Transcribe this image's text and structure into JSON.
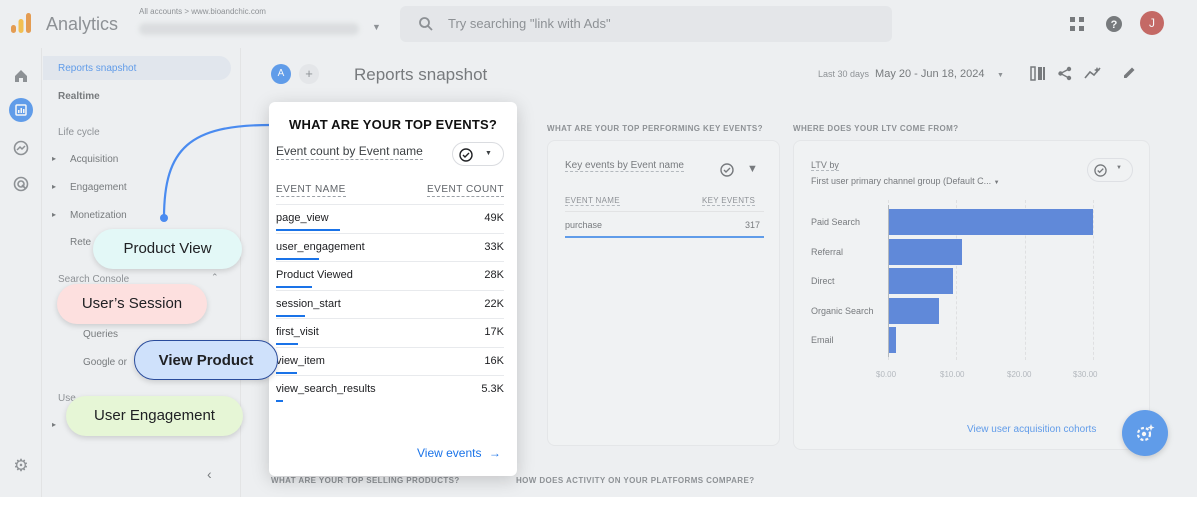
{
  "topbar": {
    "app_title": "Analytics",
    "account_crumb": "All accounts > www.bioandchic.com",
    "search_placeholder": "Try searching \"link with Ads\"",
    "avatar_letter": "J"
  },
  "nav": {
    "reports_snapshot": "Reports snapshot",
    "realtime": "Realtime",
    "lifecycle": "Life cycle",
    "acquisition": "Acquisition",
    "engagement": "Engagement",
    "monetization": "Monetization",
    "retention": "Rete",
    "search_console": "Search Console",
    "queries": "Queries",
    "google_organic": "Google or",
    "user_section": "Use"
  },
  "header": {
    "comparison_chip": "A",
    "add_comparison": "+",
    "page_title": "Reports snapshot",
    "date_label": "Last 30 days",
    "date_range": "May 20 - Jun 18, 2024"
  },
  "key_events_card": {
    "section_label": "WHAT ARE YOUR TOP PERFORMING KEY EVENTS?",
    "title": "Key events by Event name",
    "col_name": "EVENT NAME",
    "col_value": "KEY EVENTS",
    "rows": [
      {
        "name": "purchase",
        "value": "317"
      }
    ]
  },
  "ltv_card": {
    "section_label": "WHERE DOES YOUR LTV COME FROM?",
    "title_line1": "LTV by",
    "title_line2": "First user primary channel group (Default C...",
    "link": "View user acquisition cohorts"
  },
  "chart_data": {
    "type": "bar",
    "orientation": "horizontal",
    "title": "LTV by First user primary channel group (Default C...",
    "categories": [
      "Paid Search",
      "Referral",
      "Direct",
      "Organic Search",
      "Email"
    ],
    "values": [
      30.5,
      10.8,
      9.5,
      7.4,
      1.2
    ],
    "xticks": [
      "$0.00",
      "$10.00",
      "$20.00",
      "$30.00"
    ],
    "xlim": [
      0,
      30
    ],
    "grid": true
  },
  "bottom_sections": {
    "top_selling": "WHAT ARE YOUR TOP SELLING PRODUCTS?",
    "platforms": "HOW DOES ACTIVITY ON YOUR PLATFORMS COMPARE?"
  },
  "popup": {
    "title": "WHAT ARE YOUR TOP EVENTS?",
    "subtitle": "Event count by Event name",
    "col_name": "EVENT NAME",
    "col_count": "EVENT COUNT",
    "rows": [
      {
        "name": "page_view",
        "count": "49K",
        "fraction": 1.0
      },
      {
        "name": "user_engagement",
        "count": "33K",
        "fraction": 0.67
      },
      {
        "name": "Product Viewed",
        "count": "28K",
        "fraction": 0.57
      },
      {
        "name": "session_start",
        "count": "22K",
        "fraction": 0.45
      },
      {
        "name": "first_visit",
        "count": "17K",
        "fraction": 0.35
      },
      {
        "name": "view_item",
        "count": "16K",
        "fraction": 0.33
      },
      {
        "name": "view_search_results",
        "count": "5.3K",
        "fraction": 0.11
      }
    ],
    "link": "View events"
  },
  "pills": {
    "product_view": "Product View",
    "users_session": "User’s Session",
    "view_product": "View Product",
    "user_engagement": "User Engagement"
  },
  "colors": {
    "accent": "#1a73e8",
    "bar": "#1a56d0",
    "pill_product_view": "#e3f8f7",
    "pill_users_session": "#fde0df",
    "pill_view_product": "#cfe1fb",
    "pill_user_engagement": "#e6f6d6"
  }
}
